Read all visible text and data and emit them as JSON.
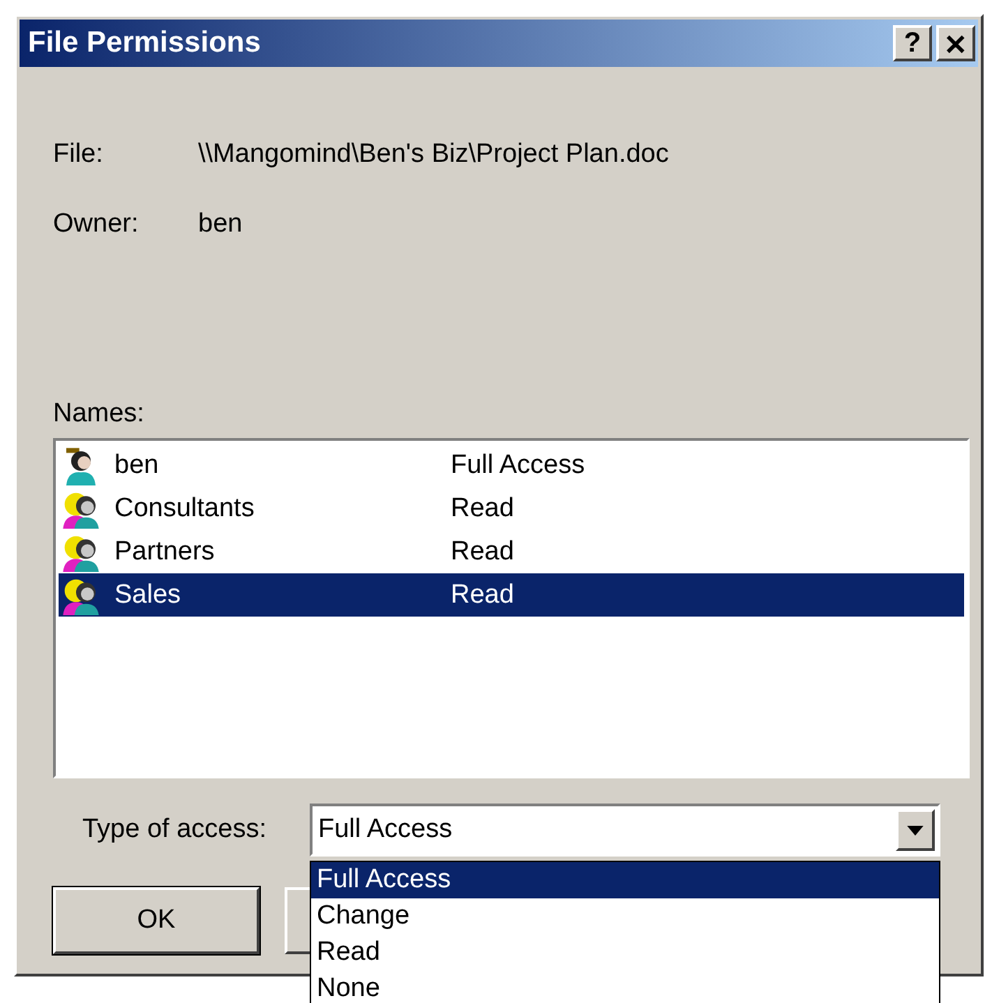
{
  "window": {
    "title": "File Permissions",
    "help_button": "?",
    "close_button": "✕"
  },
  "file": {
    "label": "File:",
    "value": "\\\\Mangomind\\Ben's Biz\\Project Plan.doc"
  },
  "owner": {
    "label": "Owner:",
    "value": "ben"
  },
  "names": {
    "label": "Names:",
    "rows": [
      {
        "name": "ben",
        "access": "Full Access",
        "kind": "user",
        "selected": false
      },
      {
        "name": "Consultants",
        "access": "Read",
        "kind": "group",
        "selected": false
      },
      {
        "name": "Partners",
        "access": "Read",
        "kind": "group",
        "selected": false
      },
      {
        "name": "Sales",
        "access": "Read",
        "kind": "group",
        "selected": true
      }
    ]
  },
  "type_of_access": {
    "label": "Type of access:",
    "value": "Full Access",
    "expanded": true,
    "options": [
      {
        "label": "Full Access",
        "selected": true
      },
      {
        "label": "Change",
        "selected": false
      },
      {
        "label": "Read",
        "selected": false
      },
      {
        "label": "None",
        "selected": false
      }
    ]
  },
  "buttons": [
    "OK"
  ]
}
